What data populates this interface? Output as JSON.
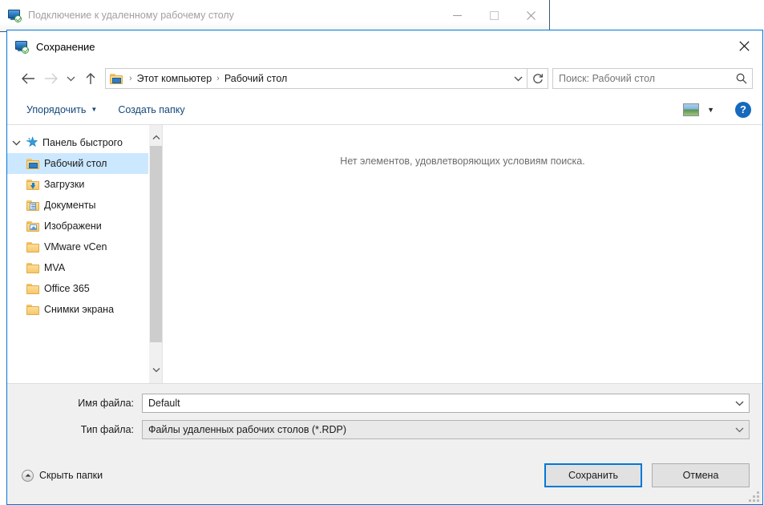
{
  "background_window": {
    "title": "Подключение к удаленному рабочему столу",
    "icon": "remote-desktop-icon",
    "controls": {
      "minimize": "minimize-icon",
      "maximize": "maximize-icon",
      "close": "close-icon"
    }
  },
  "dialog": {
    "title": "Сохранение",
    "icon": "remote-desktop-icon",
    "close_label": "close-icon",
    "accent_color": "#0078d7"
  },
  "navigation": {
    "back": "back-arrow-icon",
    "forward": "forward-arrow-icon",
    "recent": "chevron-down-icon",
    "up": "up-arrow-icon",
    "address_icon": "desktop-folder-icon",
    "breadcrumbs": [
      "Этот компьютер",
      "Рабочий стол"
    ],
    "breadcrumb_separator": "›",
    "address_dropdown": "chevron-down-icon",
    "refresh": "refresh-icon"
  },
  "search": {
    "placeholder": "Поиск: Рабочий стол",
    "value": "",
    "icon": "search-icon"
  },
  "command_bar": {
    "organize_label": "Упорядочить",
    "organize_caret": "▼",
    "new_folder_label": "Создать папку",
    "view_icon": "view-layout-icon",
    "view_caret": "▼",
    "help_label": "?"
  },
  "nav_pane": {
    "root": {
      "label": "Панель быстрого",
      "icon": "star-icon",
      "chevron": "chevron-down-icon",
      "expanded": true
    },
    "items": [
      {
        "label": "Рабочий стол",
        "icon": "desktop-folder-icon",
        "pinned": true,
        "selected": true
      },
      {
        "label": "Загрузки",
        "icon": "downloads-folder-icon",
        "pinned": true,
        "selected": false
      },
      {
        "label": "Документы",
        "icon": "documents-folder-icon",
        "pinned": true,
        "selected": false
      },
      {
        "label": "Изображени",
        "icon": "pictures-folder-icon",
        "pinned": true,
        "selected": false
      },
      {
        "label": "VMware vCen",
        "icon": "folder-icon",
        "pinned": true,
        "selected": false
      },
      {
        "label": "MVA",
        "icon": "folder-icon",
        "pinned": false,
        "selected": false
      },
      {
        "label": "Office 365",
        "icon": "folder-icon",
        "pinned": false,
        "selected": false
      },
      {
        "label": "Снимки экрана",
        "icon": "folder-icon",
        "pinned": false,
        "selected": false
      }
    ],
    "scrollbar": {
      "up_arrow": "chevron-up-icon",
      "down_arrow": "chevron-down-icon"
    }
  },
  "file_list": {
    "empty_message": "Нет элементов, удовлетворяющих условиям поиска."
  },
  "form": {
    "file_name_label": "Имя файла:",
    "file_name_value": "Default",
    "file_type_label": "Тип файла:",
    "file_type_value": "Файлы удаленных рабочих столов (*.RDP)",
    "caret": "chevron-down-icon"
  },
  "footer": {
    "hide_folders_label": "Скрыть папки",
    "hide_folders_icon": "chevron-up-circle-icon",
    "save_label": "Сохранить",
    "cancel_label": "Отмена",
    "resize_grip": "resize-grip-icon"
  }
}
